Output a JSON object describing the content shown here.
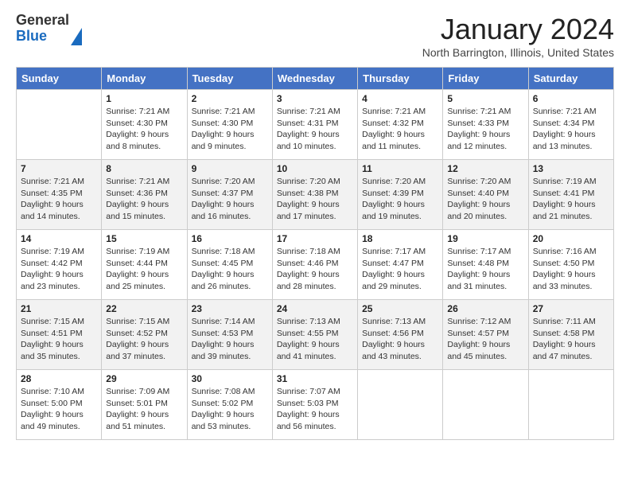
{
  "header": {
    "logo_line1": "General",
    "logo_line2": "Blue",
    "month_title": "January 2024",
    "location": "North Barrington, Illinois, United States"
  },
  "weekdays": [
    "Sunday",
    "Monday",
    "Tuesday",
    "Wednesday",
    "Thursday",
    "Friday",
    "Saturday"
  ],
  "weeks": [
    [
      {
        "day": "",
        "sunrise": "",
        "sunset": "",
        "daylight": ""
      },
      {
        "day": "1",
        "sunrise": "Sunrise: 7:21 AM",
        "sunset": "Sunset: 4:30 PM",
        "daylight": "Daylight: 9 hours and 8 minutes."
      },
      {
        "day": "2",
        "sunrise": "Sunrise: 7:21 AM",
        "sunset": "Sunset: 4:30 PM",
        "daylight": "Daylight: 9 hours and 9 minutes."
      },
      {
        "day": "3",
        "sunrise": "Sunrise: 7:21 AM",
        "sunset": "Sunset: 4:31 PM",
        "daylight": "Daylight: 9 hours and 10 minutes."
      },
      {
        "day": "4",
        "sunrise": "Sunrise: 7:21 AM",
        "sunset": "Sunset: 4:32 PM",
        "daylight": "Daylight: 9 hours and 11 minutes."
      },
      {
        "day": "5",
        "sunrise": "Sunrise: 7:21 AM",
        "sunset": "Sunset: 4:33 PM",
        "daylight": "Daylight: 9 hours and 12 minutes."
      },
      {
        "day": "6",
        "sunrise": "Sunrise: 7:21 AM",
        "sunset": "Sunset: 4:34 PM",
        "daylight": "Daylight: 9 hours and 13 minutes."
      }
    ],
    [
      {
        "day": "7",
        "sunrise": "Sunrise: 7:21 AM",
        "sunset": "Sunset: 4:35 PM",
        "daylight": "Daylight: 9 hours and 14 minutes."
      },
      {
        "day": "8",
        "sunrise": "Sunrise: 7:21 AM",
        "sunset": "Sunset: 4:36 PM",
        "daylight": "Daylight: 9 hours and 15 minutes."
      },
      {
        "day": "9",
        "sunrise": "Sunrise: 7:20 AM",
        "sunset": "Sunset: 4:37 PM",
        "daylight": "Daylight: 9 hours and 16 minutes."
      },
      {
        "day": "10",
        "sunrise": "Sunrise: 7:20 AM",
        "sunset": "Sunset: 4:38 PM",
        "daylight": "Daylight: 9 hours and 17 minutes."
      },
      {
        "day": "11",
        "sunrise": "Sunrise: 7:20 AM",
        "sunset": "Sunset: 4:39 PM",
        "daylight": "Daylight: 9 hours and 19 minutes."
      },
      {
        "day": "12",
        "sunrise": "Sunrise: 7:20 AM",
        "sunset": "Sunset: 4:40 PM",
        "daylight": "Daylight: 9 hours and 20 minutes."
      },
      {
        "day": "13",
        "sunrise": "Sunrise: 7:19 AM",
        "sunset": "Sunset: 4:41 PM",
        "daylight": "Daylight: 9 hours and 21 minutes."
      }
    ],
    [
      {
        "day": "14",
        "sunrise": "Sunrise: 7:19 AM",
        "sunset": "Sunset: 4:42 PM",
        "daylight": "Daylight: 9 hours and 23 minutes."
      },
      {
        "day": "15",
        "sunrise": "Sunrise: 7:19 AM",
        "sunset": "Sunset: 4:44 PM",
        "daylight": "Daylight: 9 hours and 25 minutes."
      },
      {
        "day": "16",
        "sunrise": "Sunrise: 7:18 AM",
        "sunset": "Sunset: 4:45 PM",
        "daylight": "Daylight: 9 hours and 26 minutes."
      },
      {
        "day": "17",
        "sunrise": "Sunrise: 7:18 AM",
        "sunset": "Sunset: 4:46 PM",
        "daylight": "Daylight: 9 hours and 28 minutes."
      },
      {
        "day": "18",
        "sunrise": "Sunrise: 7:17 AM",
        "sunset": "Sunset: 4:47 PM",
        "daylight": "Daylight: 9 hours and 29 minutes."
      },
      {
        "day": "19",
        "sunrise": "Sunrise: 7:17 AM",
        "sunset": "Sunset: 4:48 PM",
        "daylight": "Daylight: 9 hours and 31 minutes."
      },
      {
        "day": "20",
        "sunrise": "Sunrise: 7:16 AM",
        "sunset": "Sunset: 4:50 PM",
        "daylight": "Daylight: 9 hours and 33 minutes."
      }
    ],
    [
      {
        "day": "21",
        "sunrise": "Sunrise: 7:15 AM",
        "sunset": "Sunset: 4:51 PM",
        "daylight": "Daylight: 9 hours and 35 minutes."
      },
      {
        "day": "22",
        "sunrise": "Sunrise: 7:15 AM",
        "sunset": "Sunset: 4:52 PM",
        "daylight": "Daylight: 9 hours and 37 minutes."
      },
      {
        "day": "23",
        "sunrise": "Sunrise: 7:14 AM",
        "sunset": "Sunset: 4:53 PM",
        "daylight": "Daylight: 9 hours and 39 minutes."
      },
      {
        "day": "24",
        "sunrise": "Sunrise: 7:13 AM",
        "sunset": "Sunset: 4:55 PM",
        "daylight": "Daylight: 9 hours and 41 minutes."
      },
      {
        "day": "25",
        "sunrise": "Sunrise: 7:13 AM",
        "sunset": "Sunset: 4:56 PM",
        "daylight": "Daylight: 9 hours and 43 minutes."
      },
      {
        "day": "26",
        "sunrise": "Sunrise: 7:12 AM",
        "sunset": "Sunset: 4:57 PM",
        "daylight": "Daylight: 9 hours and 45 minutes."
      },
      {
        "day": "27",
        "sunrise": "Sunrise: 7:11 AM",
        "sunset": "Sunset: 4:58 PM",
        "daylight": "Daylight: 9 hours and 47 minutes."
      }
    ],
    [
      {
        "day": "28",
        "sunrise": "Sunrise: 7:10 AM",
        "sunset": "Sunset: 5:00 PM",
        "daylight": "Daylight: 9 hours and 49 minutes."
      },
      {
        "day": "29",
        "sunrise": "Sunrise: 7:09 AM",
        "sunset": "Sunset: 5:01 PM",
        "daylight": "Daylight: 9 hours and 51 minutes."
      },
      {
        "day": "30",
        "sunrise": "Sunrise: 7:08 AM",
        "sunset": "Sunset: 5:02 PM",
        "daylight": "Daylight: 9 hours and 53 minutes."
      },
      {
        "day": "31",
        "sunrise": "Sunrise: 7:07 AM",
        "sunset": "Sunset: 5:03 PM",
        "daylight": "Daylight: 9 hours and 56 minutes."
      },
      {
        "day": "",
        "sunrise": "",
        "sunset": "",
        "daylight": ""
      },
      {
        "day": "",
        "sunrise": "",
        "sunset": "",
        "daylight": ""
      },
      {
        "day": "",
        "sunrise": "",
        "sunset": "",
        "daylight": ""
      }
    ]
  ]
}
